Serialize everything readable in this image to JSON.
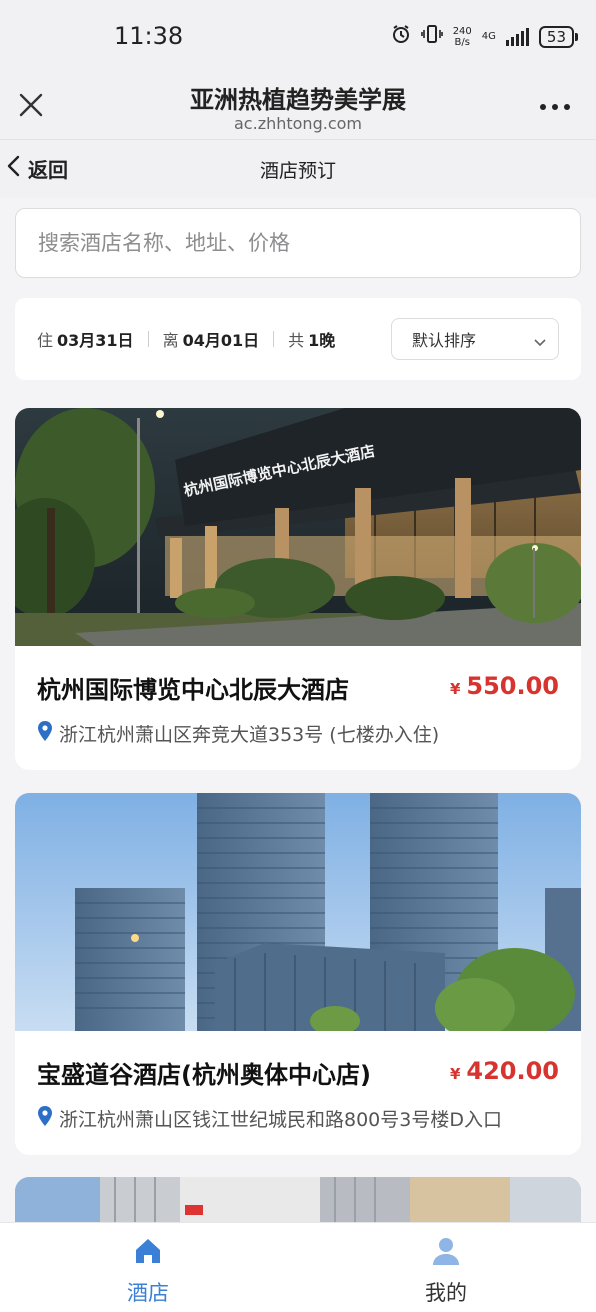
{
  "status_bar": {
    "time": "11:38",
    "net_speed_value": "240",
    "net_speed_unit": "B/s",
    "network": "4G",
    "battery": "53"
  },
  "title_bar": {
    "title": "亚洲热植趋势美学展",
    "domain": "ac.zhhtong.com"
  },
  "nav": {
    "back_label": "返回",
    "title": "酒店预订"
  },
  "search": {
    "placeholder": "搜索酒店名称、地址、价格"
  },
  "booking": {
    "checkin_prefix": "住",
    "checkin_date": "03月31日",
    "checkout_prefix": "离",
    "checkout_date": "04月01日",
    "nights_prefix": "共",
    "nights_value": "1晚",
    "sort_selected": "默认排序"
  },
  "hotels": [
    {
      "name": "杭州国际博览中心北辰大酒店",
      "currency": "¥",
      "price": "550.00",
      "address": "浙江杭州萧山区奔竞大道353号 (七楼办入住)",
      "photo_sign": "杭州国际博览中心北辰大酒店"
    },
    {
      "name": "宝盛道谷酒店(杭州奥体中心店)",
      "currency": "¥",
      "price": "420.00",
      "address": "浙江杭州萧山区钱江世纪城民和路800号3号楼D入口"
    }
  ],
  "tabs": [
    {
      "label": "酒店",
      "icon": "home-icon",
      "active": true
    },
    {
      "label": "我的",
      "icon": "user-icon",
      "active": false
    }
  ],
  "colors": {
    "accent": "#3b7fd6",
    "price": "#d7332f",
    "page_bg": "#f4f4f6",
    "inactive_tab_icon": "#8fb5e6"
  }
}
